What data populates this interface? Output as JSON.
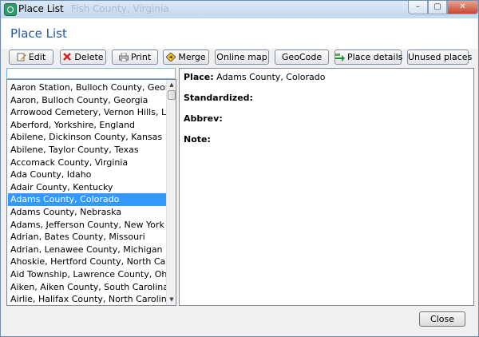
{
  "window": {
    "title": "Place List",
    "ghost_text": "Fish County, Virginia",
    "minimize": "–",
    "maximize": "▢",
    "close": "✕"
  },
  "heading": "Place List",
  "toolbar": {
    "edit": "Edit",
    "delete": "Delete",
    "print": "Print",
    "merge": "Merge",
    "online_map": "Online map",
    "geocode": "GeoCode",
    "place_details": "Place details",
    "unused_places": "Unused places"
  },
  "search": {
    "value": ""
  },
  "places": [
    "Aaron Station, Bulloch County, Georgia",
    "Aaron, Bulloch County, Georgia",
    "Arrowood Cemetery, Vernon Hills, Lake Co",
    "Aberford, Yorkshire, England",
    "Abilene, Dickinson County, Kansas",
    "Abilene, Taylor County, Texas",
    "Accomack County, Virginia",
    "Ada County, Idaho",
    "Adair County, Kentucky",
    "Adams County, Colorado",
    "Adams County, Nebraska",
    "Adams, Jefferson County, New York",
    "Adrian, Bates County, Missouri",
    "Adrian, Lenawee County, Michigan",
    "Ahoskie, Hertford County, North Carolina",
    "Aid Township, Lawrence County, Ohio",
    "Aiken, Aiken County, South Carolina",
    "Airlie, Halifax County, North Carolina"
  ],
  "selected_index": 9,
  "details": {
    "place_label": "Place:",
    "place_value": "Adams County, Colorado",
    "standardized_label": "Standardized:",
    "abbrev_label": "Abbrev:",
    "note_label": "Note:"
  },
  "close_label": "Close"
}
